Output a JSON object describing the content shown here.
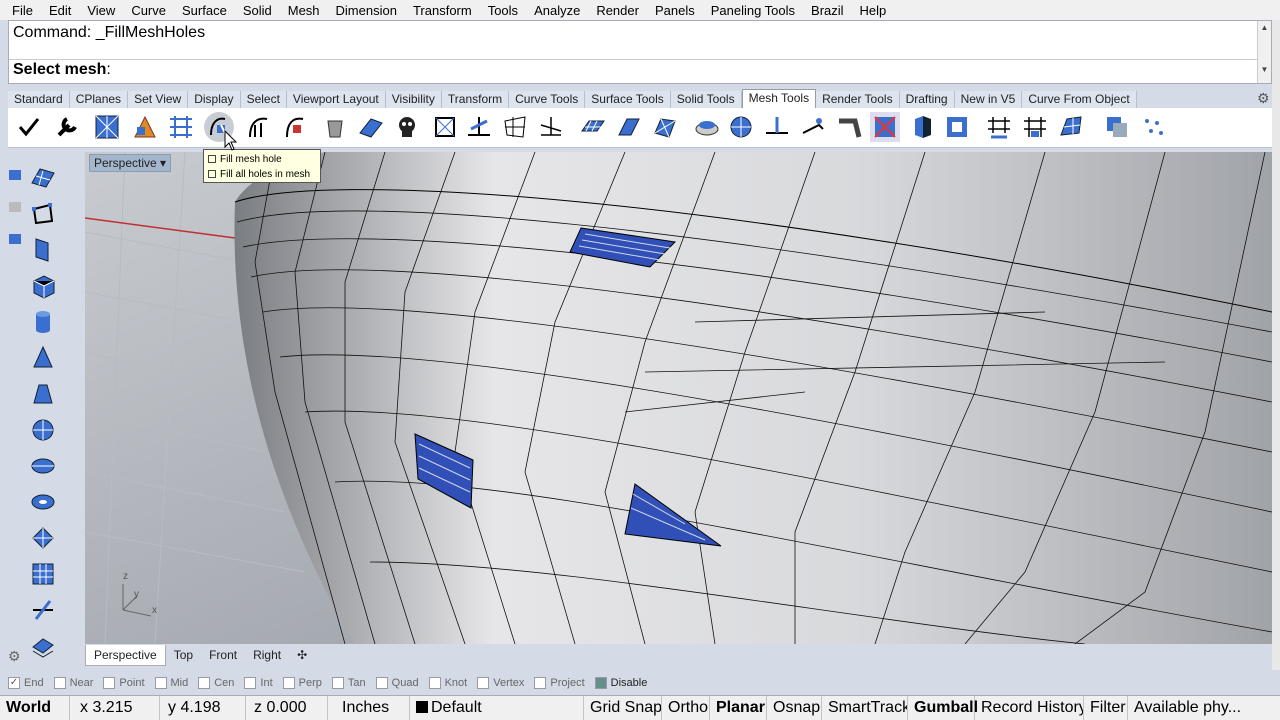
{
  "menu": [
    "File",
    "Edit",
    "View",
    "Curve",
    "Surface",
    "Solid",
    "Mesh",
    "Dimension",
    "Transform",
    "Tools",
    "Analyze",
    "Render",
    "Panels",
    "Paneling Tools",
    "Brazil",
    "Help"
  ],
  "command": {
    "line": "Command: _FillMeshHoles",
    "prompt_bold": "Select mesh",
    "prompt_rest": ":"
  },
  "toolbar_tabs": [
    "Standard",
    "CPlanes",
    "Set View",
    "Display",
    "Select",
    "Viewport Layout",
    "Visibility",
    "Transform",
    "Curve Tools",
    "Surface Tools",
    "Solid Tools",
    "Mesh Tools",
    "Render Tools",
    "Drafting",
    "New in V5",
    "Curve From Object"
  ],
  "active_tab": "Mesh Tools",
  "tooltip": {
    "line1": "Fill mesh hole",
    "line2": "Fill all holes in mesh"
  },
  "viewport": {
    "title": "Perspective",
    "axes": {
      "x": "x",
      "y": "y",
      "z": "z"
    }
  },
  "viewport_tabs": [
    "Perspective",
    "Top",
    "Front",
    "Right"
  ],
  "osnaps": [
    {
      "label": "End",
      "checked": true
    },
    {
      "label": "Near",
      "checked": false
    },
    {
      "label": "Point",
      "checked": false
    },
    {
      "label": "Mid",
      "checked": false
    },
    {
      "label": "Cen",
      "checked": false
    },
    {
      "label": "Int",
      "checked": false
    },
    {
      "label": "Perp",
      "checked": false
    },
    {
      "label": "Tan",
      "checked": false
    },
    {
      "label": "Quad",
      "checked": false
    },
    {
      "label": "Knot",
      "checked": false
    },
    {
      "label": "Vertex",
      "checked": false
    },
    {
      "label": "Project",
      "checked": false
    },
    {
      "label": "Disable",
      "checked": true
    }
  ],
  "status": {
    "cplane": "World",
    "x": "x 3.215",
    "y": "y 4.198",
    "z": "z 0.000",
    "units": "Inches",
    "layer": "Default",
    "grid_snap": "Grid Snap",
    "ortho": "Ortho",
    "planar": "Planar",
    "osnap": "Osnap",
    "smarttrack": "SmartTrack",
    "gumball": "Gumball",
    "record_history": "Record History",
    "filter": "Filter",
    "memory": "Available phy..."
  },
  "colors": {
    "hole_fill": "#3050b8",
    "axis_red": "#c03030",
    "viewport_bg": "#a9adb4"
  }
}
